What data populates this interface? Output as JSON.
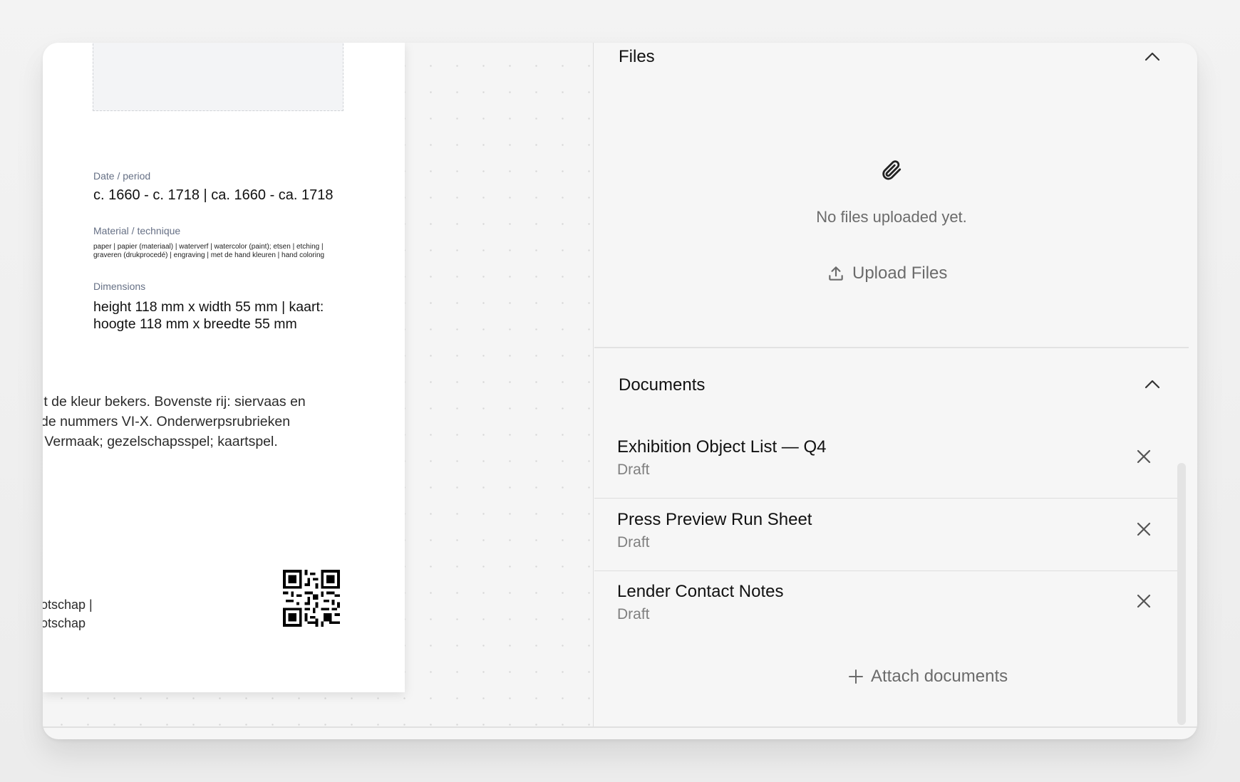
{
  "label": {
    "date_label": "Date / period",
    "date_value": "c. 1660 - c. 1718 | ca. 1660 - ca. 1718",
    "material_label": "Material / technique",
    "material_value": "paper | papier (materiaal) | waterverf | watercolor (paint); etsen | etching | graveren (drukprocedé) | engraving | met de hand kleuren | hand coloring",
    "dimensions_label": "Dimensions",
    "dimensions_value": "height 118 mm x width 55 mm | kaart: hoogte 118 mm x breedte 55 mm",
    "description": "it de kleur bekers. Bovenste rij: siervaas en\nde nummers VI-X. Onderwerpsrubrieken\n Vermaak; gezelschapsspel; kaartspel.",
    "credit": "otschap |\notschap"
  },
  "files": {
    "title": "Files",
    "empty_text": "No files uploaded yet.",
    "upload_label": "Upload Files"
  },
  "documents": {
    "title": "Documents",
    "items": [
      {
        "title": "Exhibition Object List — Q4",
        "status": "Draft"
      },
      {
        "title": "Press Preview Run Sheet",
        "status": "Draft"
      },
      {
        "title": "Lender Contact Notes",
        "status": "Draft"
      }
    ],
    "attach_label": "Attach documents"
  },
  "icons": {
    "files_empty": "paperclip-icon",
    "upload": "upload-icon",
    "collapse": "chevron-up-icon",
    "remove": "close-icon",
    "attach": "plus-icon"
  }
}
